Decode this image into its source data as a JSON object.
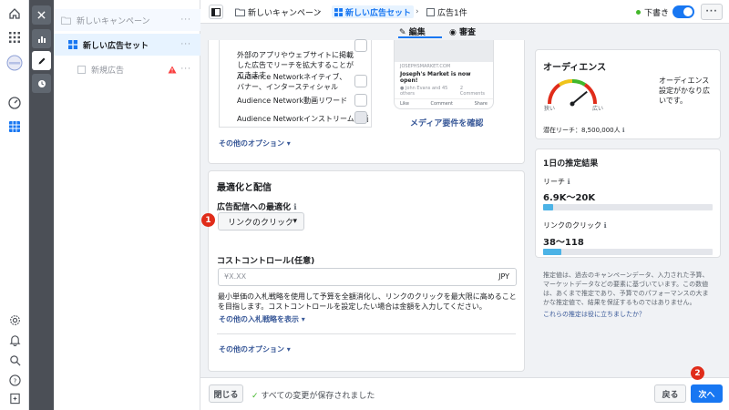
{
  "topbar": {
    "crumbs": [
      "新しいキャンペーン",
      "新しい広告セット",
      "広告1件"
    ],
    "status": "下書き",
    "more": "···"
  },
  "tree": {
    "campaign": "新しいキャンペーン",
    "adset": "新しい広告セット",
    "ad": "新規広告",
    "more": "···"
  },
  "preview_tabs": {
    "edit": "編集",
    "review": "審査"
  },
  "placements": {
    "intro": "外部のアプリやウェブサイトに掲載した広告でリーチを拡大することができます",
    "options": [
      "Audience Networkネイティブ、バナー、インタースティシャル",
      "Audience Network動画リワード",
      "Audience Networkインストリーム動画"
    ],
    "media_link": "メディア要件を確認",
    "more_options": "その他のオプション ▾"
  },
  "preview_mock": {
    "headline": "Joseph's Market is now open!",
    "like": "Like",
    "comment": "Comment",
    "share": "Share",
    "comments_count": "2 Comments"
  },
  "optimization": {
    "section_title": "最適化と配信",
    "goal_label": "広告配信への最適化",
    "goal_value": "リンクのクリック",
    "cost_label": "コストコントロール(任意)",
    "cost_placeholder": "¥X.XX",
    "currency": "JPY",
    "help_text": "最小単価の入札戦略を使用して予算を全額消化し、リンクのクリックを最大限に高めることを目指します。コストコントロールを設定したい場合は金額を入力してください。",
    "bid_link": "その他の入札戦略を表示 ▾",
    "more_options": "その他のオプション ▾"
  },
  "audience": {
    "title": "オーディエンス",
    "desc": "オーディエンス設定がかなり広いです。",
    "narrow": "狭い",
    "wide": "広い",
    "reach_label": "潜在リーチ：8,500,000人",
    "gauge_level": 0.78
  },
  "daily": {
    "title": "1日の推定結果",
    "reach_label": "リーチ",
    "reach_value": "6.9K〜20K",
    "reach_level": 0.06,
    "clicks_label": "リンクのクリック",
    "clicks_value": "38〜118",
    "clicks_level": 0.11,
    "note": "推定値は、過去のキャンペーンデータ、入力された予算、マーケットデータなどの要素に基づいています。この数値は、あくまで推定であり、予算でのパフォーマンスの大まかな推定値で、結果を保証するものではありません。",
    "feedback": "これらの推定は役に立ちましたか？"
  },
  "footer": {
    "close": "閉じる",
    "saved": "すべての変更が保存されました",
    "back": "戻る",
    "next": "次へ"
  },
  "badges": [
    "1",
    "2"
  ],
  "colors": {
    "accent": "#1877f2",
    "badge": "#e02c1a",
    "bar": "#4cb3e6"
  }
}
